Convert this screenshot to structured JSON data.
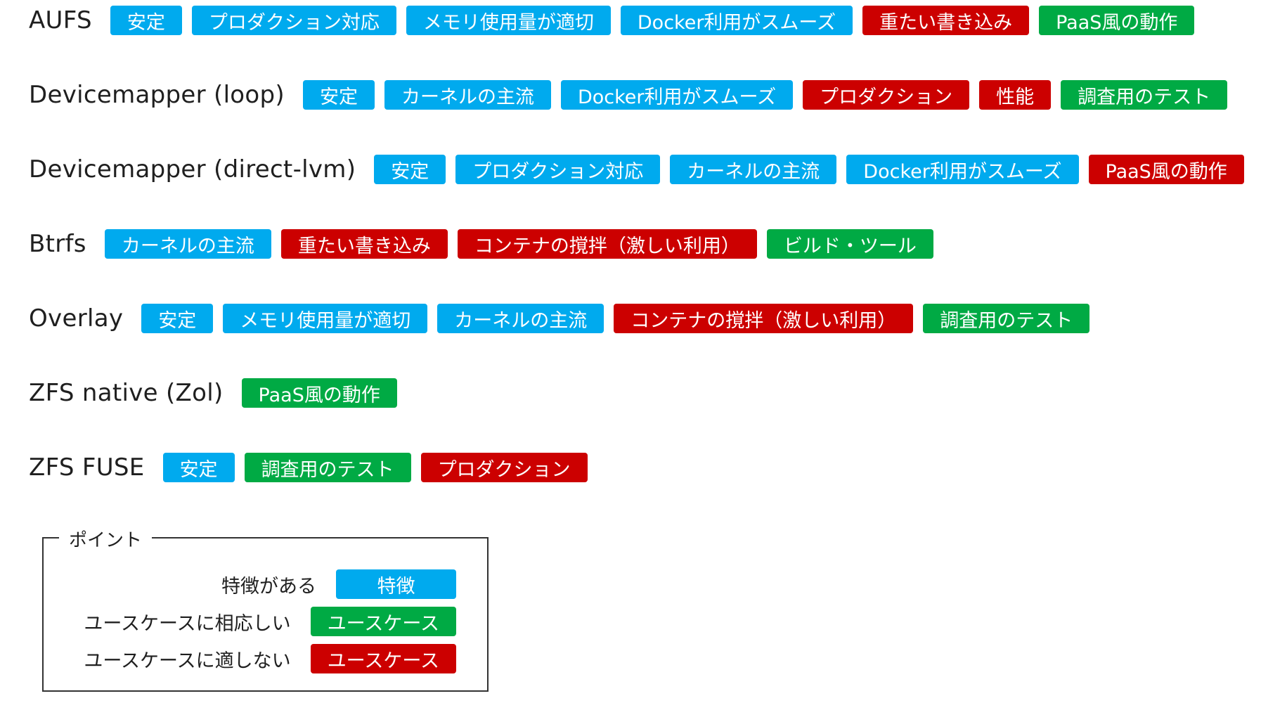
{
  "colors": {
    "feature": "#00aaee",
    "suitable": "#00aa44",
    "unsuitable": "#cc0000"
  },
  "rows": [
    {
      "label": "AUFS",
      "tags": [
        {
          "text": "安定",
          "kind": "feature"
        },
        {
          "text": "プロダクション対応",
          "kind": "feature"
        },
        {
          "text": "メモリ使用量が適切",
          "kind": "feature"
        },
        {
          "text": "Docker利用がスムーズ",
          "kind": "feature"
        },
        {
          "text": "重たい書き込み",
          "kind": "unsuitable"
        },
        {
          "text": "PaaS風の動作",
          "kind": "suitable"
        }
      ]
    },
    {
      "label": "Devicemapper (loop)",
      "tags": [
        {
          "text": "安定",
          "kind": "feature"
        },
        {
          "text": "カーネルの主流",
          "kind": "feature"
        },
        {
          "text": "Docker利用がスムーズ",
          "kind": "feature"
        },
        {
          "text": "プロダクション",
          "kind": "unsuitable"
        },
        {
          "text": "性能",
          "kind": "unsuitable"
        },
        {
          "text": "調査用のテスト",
          "kind": "suitable"
        }
      ]
    },
    {
      "label": "Devicemapper (direct-lvm)",
      "tags": [
        {
          "text": "安定",
          "kind": "feature"
        },
        {
          "text": "プロダクション対応",
          "kind": "feature"
        },
        {
          "text": "カーネルの主流",
          "kind": "feature"
        },
        {
          "text": "Docker利用がスムーズ",
          "kind": "feature"
        },
        {
          "text": "PaaS風の動作",
          "kind": "unsuitable"
        }
      ]
    },
    {
      "label": "Btrfs",
      "tags": [
        {
          "text": "カーネルの主流",
          "kind": "feature"
        },
        {
          "text": "重たい書き込み",
          "kind": "unsuitable"
        },
        {
          "text": "コンテナの撹拌（激しい利用）",
          "kind": "unsuitable"
        },
        {
          "text": "ビルド・ツール",
          "kind": "suitable"
        }
      ]
    },
    {
      "label": "Overlay",
      "tags": [
        {
          "text": "安定",
          "kind": "feature"
        },
        {
          "text": "メモリ使用量が適切",
          "kind": "feature"
        },
        {
          "text": "カーネルの主流",
          "kind": "feature"
        },
        {
          "text": "コンテナの撹拌（激しい利用）",
          "kind": "unsuitable"
        },
        {
          "text": "調査用のテスト",
          "kind": "suitable"
        }
      ]
    },
    {
      "label": "ZFS native (Zol)",
      "tags": [
        {
          "text": "PaaS風の動作",
          "kind": "suitable"
        }
      ]
    },
    {
      "label": "ZFS FUSE",
      "tags": [
        {
          "text": "安定",
          "kind": "feature"
        },
        {
          "text": "調査用のテスト",
          "kind": "suitable"
        },
        {
          "text": "プロダクション",
          "kind": "unsuitable"
        }
      ]
    }
  ],
  "legend": {
    "title": "ポイント",
    "items": [
      {
        "description": "特徴がある",
        "tag": "特徴",
        "kind": "feature"
      },
      {
        "description": "ユースケースに相応しい",
        "tag": "ユースケース",
        "kind": "suitable"
      },
      {
        "description": "ユースケースに適しない",
        "tag": "ユースケース",
        "kind": "unsuitable"
      }
    ]
  }
}
